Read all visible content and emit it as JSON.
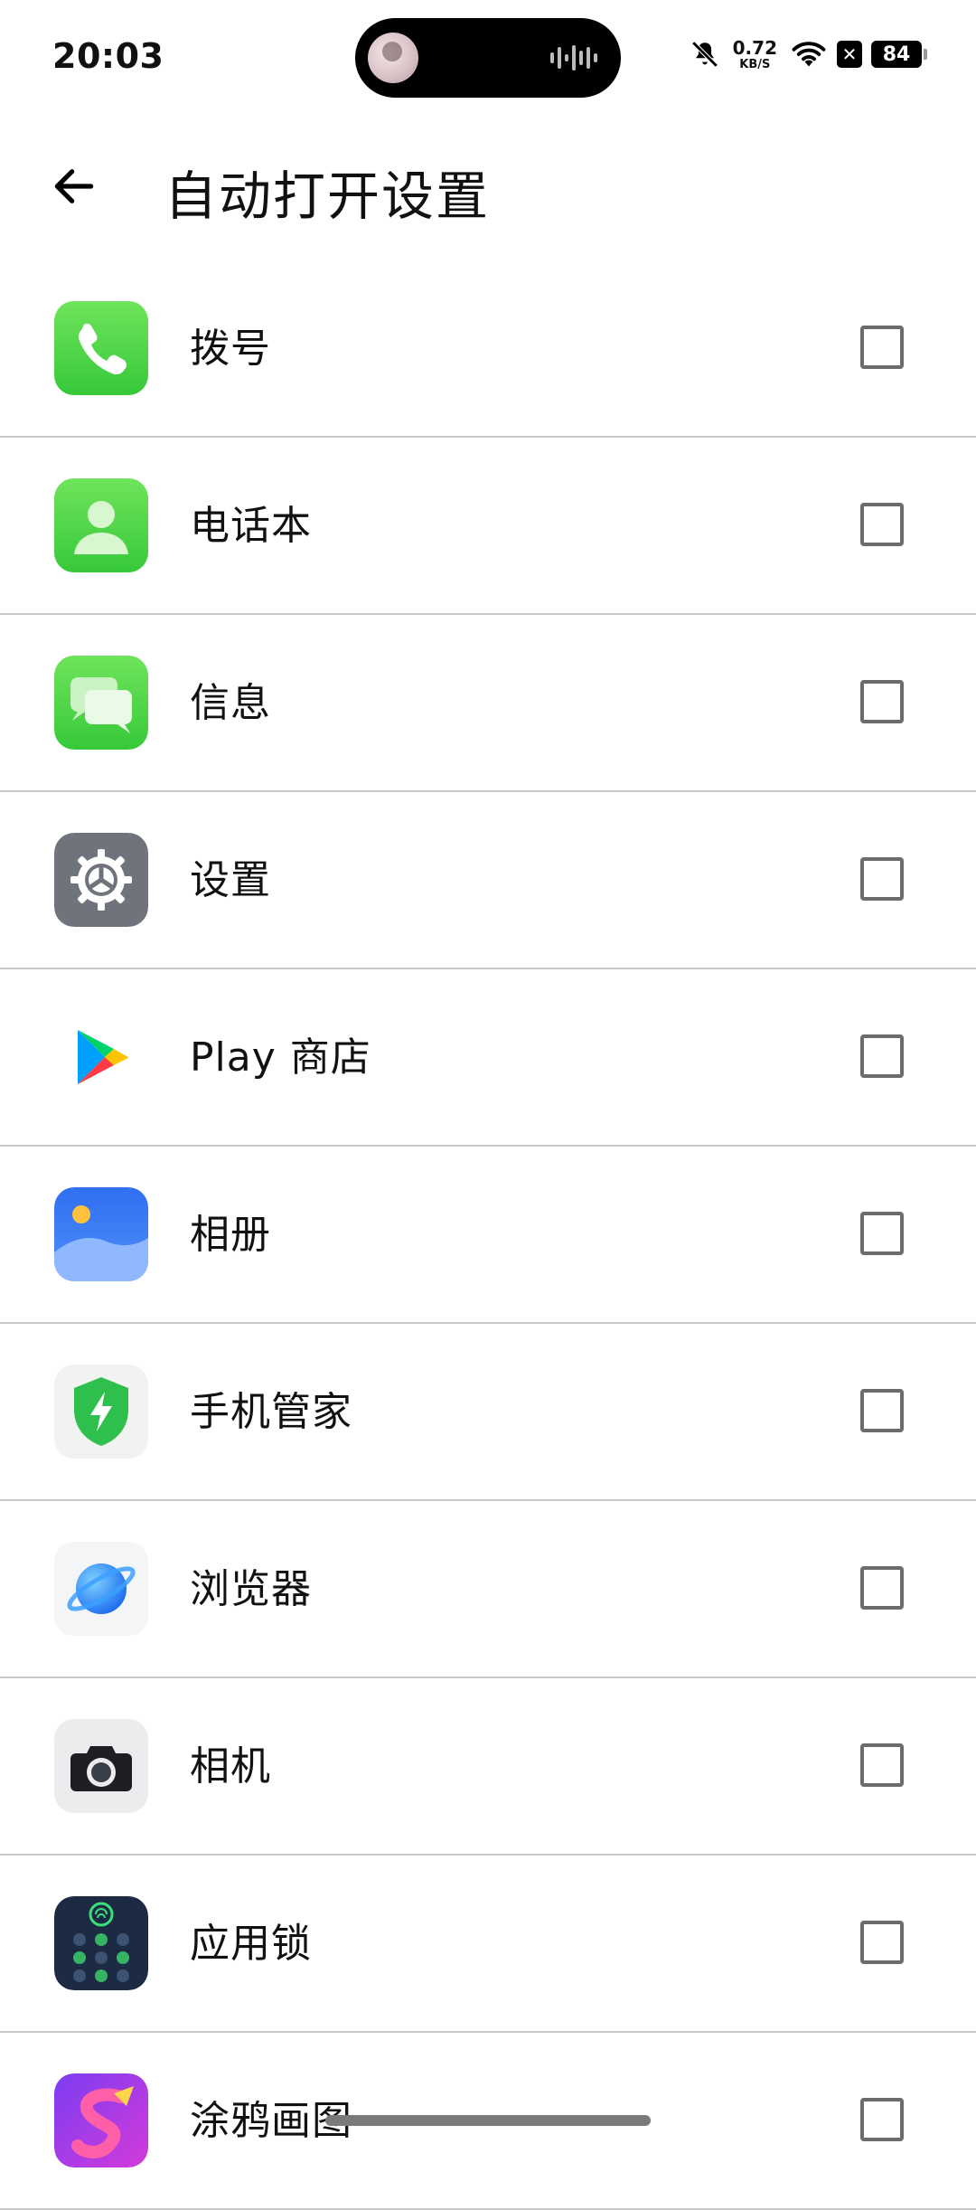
{
  "status_bar": {
    "time": "20:03",
    "net_speed_value": "0.72",
    "net_speed_unit": "KB/S",
    "sim_badge": "✕",
    "battery": "84",
    "icons": [
      "mute-bell-icon",
      "wifi-icon"
    ]
  },
  "header": {
    "title": "自动打开设置",
    "back_icon": "arrow-left-icon"
  },
  "apps": [
    {
      "label": "拨号",
      "icon": "phone-icon",
      "checked": false
    },
    {
      "label": "电话本",
      "icon": "contacts-icon",
      "checked": false
    },
    {
      "label": "信息",
      "icon": "messages-icon",
      "checked": false
    },
    {
      "label": "设置",
      "icon": "settings-gear-icon",
      "checked": false
    },
    {
      "label": "Play 商店",
      "icon": "play-store-icon",
      "checked": false
    },
    {
      "label": "相册",
      "icon": "gallery-icon",
      "checked": false
    },
    {
      "label": "手机管家",
      "icon": "phone-manager-shield-icon",
      "checked": false
    },
    {
      "label": "浏览器",
      "icon": "browser-planet-icon",
      "checked": false
    },
    {
      "label": "相机",
      "icon": "camera-icon",
      "checked": false
    },
    {
      "label": "应用锁",
      "icon": "app-lock-icon",
      "checked": false
    },
    {
      "label": "涂鸦画图",
      "icon": "doodle-icon",
      "checked": false
    }
  ],
  "colors": {
    "green": "#4cd964",
    "blue": "#3b82f6",
    "divider": "#c7c7c7"
  }
}
